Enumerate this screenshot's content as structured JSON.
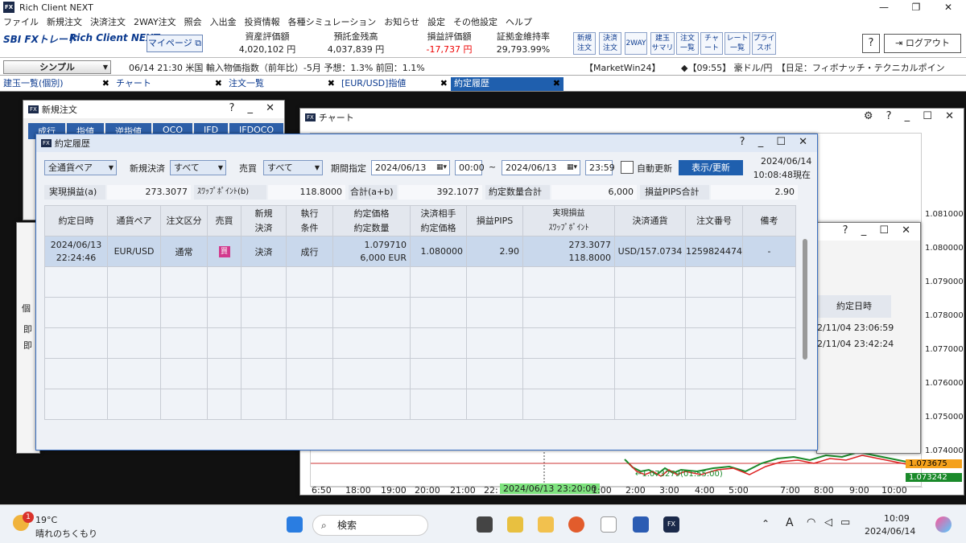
{
  "app": {
    "title": "Rich Client NEXT",
    "logo": "FX"
  },
  "window_controls": {
    "minimize": "—",
    "maximize": "❐",
    "close": "✕"
  },
  "menu": [
    "ファイル",
    "新規注文",
    "決済注文",
    "2WAY注文",
    "照会",
    "入出金",
    "投資情報",
    "各種シミュレーション",
    "お知らせ",
    "設定",
    "その他設定",
    "ヘルプ"
  ],
  "header": {
    "brand": "SBI FXトレード",
    "product": "Rich Client NEXT",
    "mypage": "マイページ ⧉",
    "stats": [
      {
        "label": "資産評価額",
        "value": "4,020,102 円",
        "neg": false
      },
      {
        "label": "預託金残高",
        "value": "4,037,839 円",
        "neg": false
      },
      {
        "label": "損益評価額",
        "value": "-17,737 円",
        "neg": true
      },
      {
        "label": "証拠金維持率",
        "value": "29,793.99%",
        "neg": false
      }
    ],
    "toolbar": [
      "新規\n注文",
      "決済\n注文",
      "2WAY",
      "建玉\nサマリ",
      "注文\n一覧",
      "チャ\nート",
      "レート\n一覧",
      "プライ\nスボ"
    ],
    "help": "?",
    "logout": "ログアウト"
  },
  "ticker": {
    "mode": "シンプル",
    "news": "06/14 21:30 米国 輸入物価指数（前年比）-5月 予想：1.3% 前回：1.1%",
    "market": "【MarketWin24】",
    "headline": "◆【09:55】 豪ドル/円　【日足：フィボナッチ・テクニカルポイン"
  },
  "tabs": [
    {
      "label": "建玉一覧(個別)",
      "active": false
    },
    {
      "label": "チャート",
      "active": false
    },
    {
      "label": "注文一覧",
      "active": false
    },
    {
      "label": "[EUR/USD]指値",
      "active": false
    },
    {
      "label": "約定履歴",
      "active": true
    }
  ],
  "new_order_window": {
    "title": "新規注文",
    "tabs": [
      "成行",
      "指値",
      "逆指値",
      "OCO",
      "IFD",
      "IFDOCO"
    ]
  },
  "chart_window": {
    "title": "チャート",
    "prices": [
      "1.081000",
      "1.080000",
      "1.079000",
      "1.078000",
      "1.077000",
      "1.076000",
      "1.075000",
      "1.074000"
    ],
    "current_price": "1.073675",
    "bid_price": "1.073242",
    "low_marker": "←1.073279(01:55:00)",
    "times": [
      "6:50",
      "18:00",
      "19:00",
      "20:00",
      "21:00",
      "22:",
      "1:00",
      "2:00",
      "3:00",
      "4:00",
      "5:00",
      "7:00",
      "8:00",
      "9:00",
      "10:00"
    ],
    "cursor_time": "2024/06/13 23:20:00"
  },
  "sub_window": {
    "col_header": "約定日時",
    "dates": [
      "2/11/04 23:06:59",
      "2/11/04 23:42:24"
    ],
    "row_labels": [
      "即",
      "即"
    ],
    "col_label": "個"
  },
  "yakujo": {
    "title": "約定履歴",
    "pair_select": "全通貨ペア",
    "new_settle_label": "新規決済",
    "new_settle_value": "すべて",
    "side_label": "売買",
    "side_value": "すべて",
    "period_label": "期間指定",
    "from_date": "2024/06/13",
    "from_time": "00:00",
    "tilde": "~",
    "to_date": "2024/06/13",
    "to_time": "23:59",
    "auto_update": "自動更新",
    "refresh": "表示/更新",
    "as_of_date": "2024/06/14",
    "as_of_time": "10:08:48現在",
    "summary": {
      "realized_label": "実現損益(a)",
      "realized": "273.3077",
      "swap_label": "ｽﾜｯﾌﾟﾎﾟｲﾝﾄ(b)",
      "swap": "118.8000",
      "total_label": "合計(a+b)",
      "total": "392.1077",
      "qty_label": "約定数量合計",
      "qty": "6,000",
      "pips_label": "損益PIPS合計",
      "pips": "2.90"
    },
    "columns": [
      "約定日時",
      "通貨ペア",
      "注文区分",
      "売買",
      "新規\n決済",
      "執行\n条件",
      "約定価格\n約定数量",
      "決済相手\n約定価格",
      "損益PIPS",
      "実現損益\nｽﾜｯﾌﾟﾎﾟｲﾝﾄ",
      "決済通貨",
      "注文番号",
      "備考"
    ],
    "row": {
      "datetime": "2024/06/13\n22:24:46",
      "pair": "EUR/USD",
      "type": "通常",
      "side": "買",
      "newsettle": "決済",
      "cond": "成行",
      "price_qty": "1.079710\n6,000 EUR",
      "counter": "1.080000",
      "pips": "2.90",
      "pl_swap": "273.3077\n118.8000",
      "currency": "USD/157.0734",
      "order_no": "1259824474",
      "note": "-"
    }
  },
  "taskbar": {
    "weather_temp": "19°C",
    "weather_desc": "晴れのちくもり",
    "badge": "1",
    "search": "検索",
    "time": "10:09",
    "date": "2024/06/14",
    "ime": "A"
  }
}
